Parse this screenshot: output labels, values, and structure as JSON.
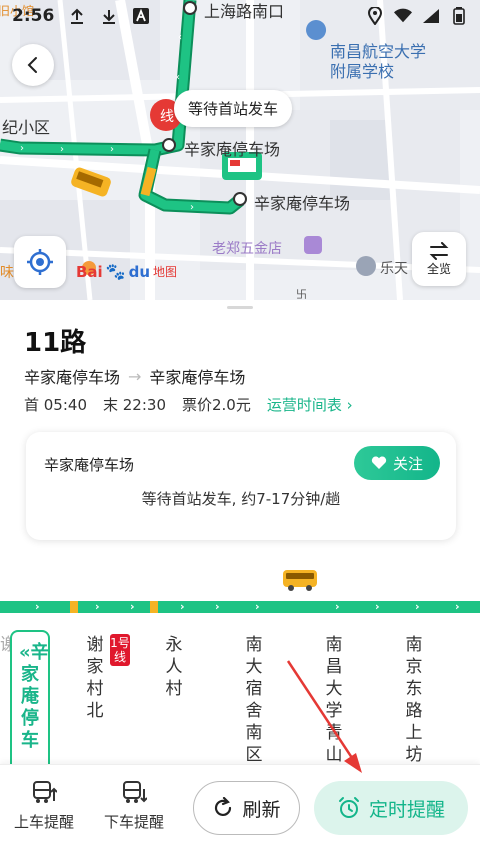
{
  "status_bar": {
    "time": "2:56",
    "icons": [
      "upload-icon",
      "download-icon",
      "font-a-icon",
      "location-icon",
      "wifi-icon",
      "signal-icon",
      "battery-icon"
    ]
  },
  "map": {
    "labels": {
      "shanghai_road_south": "上海路南口",
      "nanchang_school_1": "南昌航空大学",
      "nanchang_school_2": "附属学校",
      "community": "纪小区",
      "xinjia_stop_near": "辛家庵停车场",
      "xinjia_stop_main": "辛家庵停车场",
      "laozheng_store": "老郑五金店",
      "letian": "乐天",
      "partial_top": "旧小馆",
      "partial_left": "味",
      "partial_bottom": "卐"
    },
    "bubble": "等待首站发车",
    "overview_label": "全览",
    "baidu_logo": "Bai",
    "baidu_du": "du",
    "baidu_map_text": "地图",
    "route_color": "#1ec384",
    "route_border": "#0c8f5a"
  },
  "route": {
    "name": "11路",
    "from": "辛家庵停车场",
    "to": "辛家庵停车场",
    "first_bus": "首 05:40",
    "last_bus": "末 22:30",
    "fare": "票价2.0元",
    "schedule_link": "运营时间表 ›"
  },
  "wait_card": {
    "stop": "辛家庵停车场",
    "follow_label": "关注",
    "info": "等待首站发车, 约7-17分钟/趟"
  },
  "stations": {
    "prev_partial": "谢",
    "current": "«辛家庵停车",
    "list": [
      "谢家村北",
      "永人村",
      "南大宿舍南区",
      "南昌大学青山湖",
      "南京东路上坊路"
    ],
    "metro_badge": "1号线"
  },
  "bottom_bar": {
    "board_reminder": "上车提醒",
    "alight_reminder": "下车提醒",
    "refresh": "刷新",
    "timer_reminder": "定时提醒"
  },
  "colors": {
    "accent": "#19b58a",
    "route_green": "#1ec384",
    "metro_red": "#e0182d",
    "bus_yellow": "#f5b324"
  }
}
